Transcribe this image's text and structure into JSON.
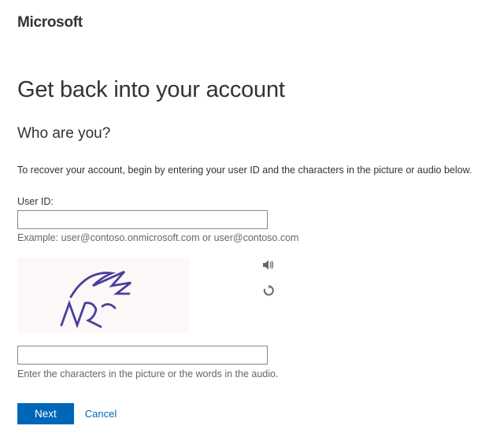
{
  "brand": "Microsoft",
  "heading": "Get back into your account",
  "subheading": "Who are you?",
  "instruction": "To recover your account, begin by entering your user ID and the characters in the picture or audio below.",
  "user_id": {
    "label": "User ID:",
    "value": "",
    "example": "Example: user@contoso.onmicrosoft.com or user@contoso.com"
  },
  "captcha": {
    "input_value": "",
    "help": "Enter the characters in the picture or the words in the audio.",
    "audio_icon": "speaker-icon",
    "refresh_icon": "refresh-icon"
  },
  "buttons": {
    "next": "Next",
    "cancel": "Cancel"
  }
}
